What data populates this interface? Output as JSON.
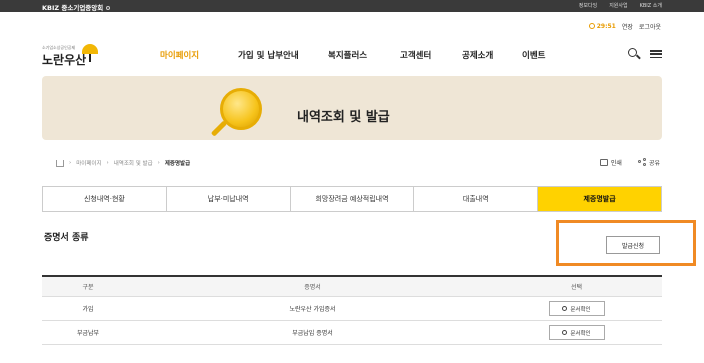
{
  "topbar": {
    "brand": "KBIZ 중소기업중앙회",
    "links": [
      "정보다잉",
      "지원사업",
      "KBIZ 소개"
    ]
  },
  "session": {
    "time": "29:51",
    "extend": "연장",
    "logout": "로그아웃"
  },
  "logo": {
    "small": "소기업소상공인공제",
    "big": "노란우산"
  },
  "nav": [
    "마이페이지",
    "가입 및 납부안내",
    "복지플러스",
    "고객센터",
    "공제소개",
    "이벤트"
  ],
  "banner": {
    "title": "내역조회 및 발급"
  },
  "breadcrumb": [
    "마이페이지",
    "내역조회 및 발급",
    "제증명발급"
  ],
  "tools": {
    "print": "인쇄",
    "share": "공유"
  },
  "tabs": [
    "신청내역·현황",
    "납부·미납내역",
    "희망장려금 예상적립내역",
    "대출내역",
    "제증명발급"
  ],
  "section": {
    "title": "증명서 종류",
    "apply_button": "발급신청"
  },
  "table": {
    "headers": [
      "구분",
      "증명서",
      "선택"
    ],
    "rows": [
      {
        "type": "가입",
        "cert": "노란우산 가입증서",
        "action": "문서확인"
      },
      {
        "type": "부금납부",
        "cert": "부금납입 증명서",
        "action": "문서확인"
      }
    ]
  },
  "colors": {
    "accent": "#ffd200",
    "highlight": "#f08a24",
    "nav_active": "#e89b00"
  }
}
